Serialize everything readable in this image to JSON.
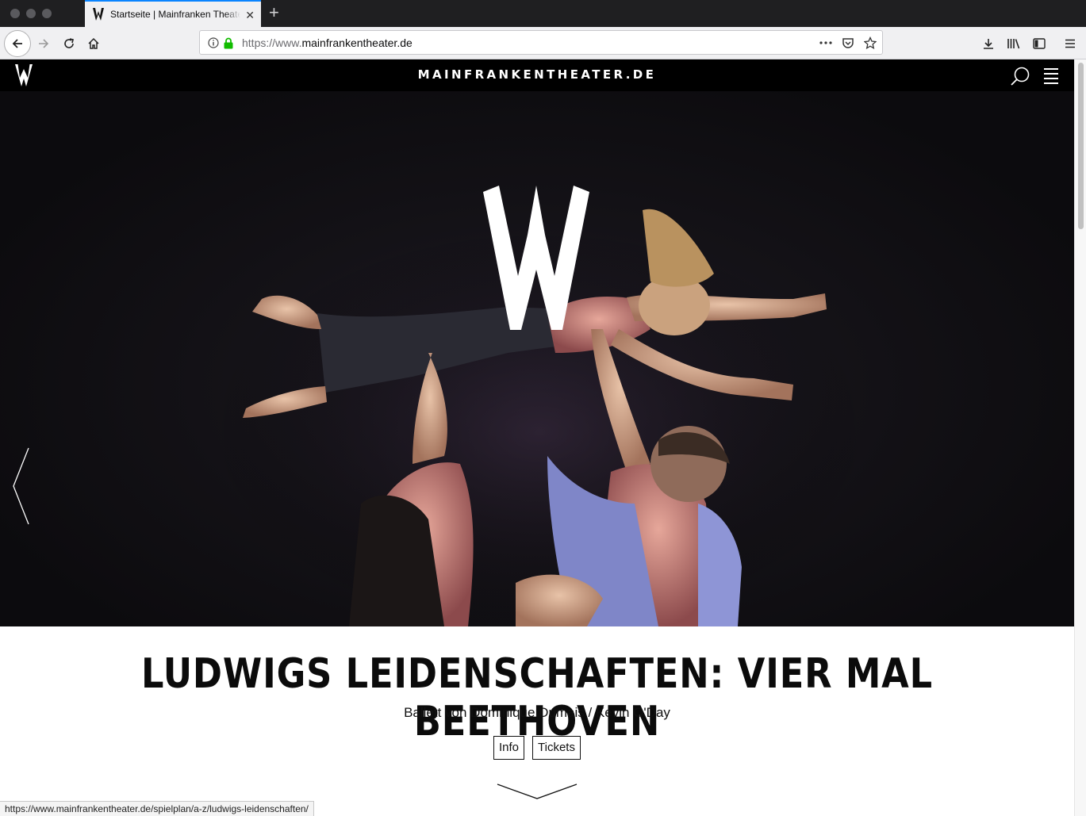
{
  "browser": {
    "tab_title": "Startseite | Mainfranken Theater Würzburg",
    "new_tab_icon": "plus-icon",
    "url_prefix": "https://www.",
    "url_host": "mainfrankentheater.de",
    "status_url": "https://www.mainfrankentheater.de/spielplan/a-z/ludwigs-leidenschaften/"
  },
  "site": {
    "title": "MAINFRANKENTHEATER.DE",
    "logo_letter": "W"
  },
  "hero": {
    "headline": "LUDWIGS LEIDENSCHAFTEN: VIER MAL BEETHOVEN",
    "subline": "Ballett von Dominique Dumais / Kevin O'Day",
    "buttons": {
      "info": "Info",
      "tickets": "Tickets"
    }
  },
  "colors": {
    "site_header": "#000000",
    "accent_tab": "#0a84ff",
    "secure_lock": "#12bc00"
  }
}
